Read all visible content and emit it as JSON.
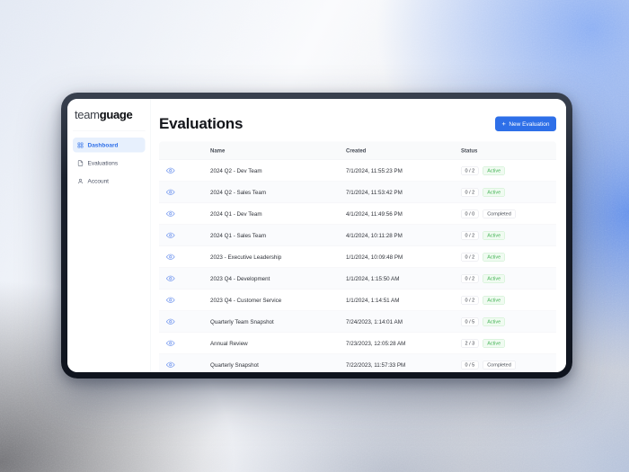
{
  "colors": {
    "accent": "#2e6fe8",
    "active_item_bg": "#e7f0fd",
    "status_green": "#44b355",
    "frame_dark": "#141a26"
  },
  "logo": {
    "part1": "team",
    "part2": "guage"
  },
  "sidebar": {
    "items": [
      {
        "label": "Dashboard",
        "icon": "dashboard-grid-icon",
        "active": true
      },
      {
        "label": "Evaluations",
        "icon": "document-icon",
        "active": false
      },
      {
        "label": "Account",
        "icon": "user-icon",
        "active": false
      }
    ]
  },
  "header": {
    "title": "Evaluations",
    "new_button_plus": "+",
    "new_button_label": "New Evaluation"
  },
  "table": {
    "columns": [
      "Name",
      "Created",
      "Status"
    ],
    "rows": [
      {
        "name": "2024 Q2 - Dev Team",
        "created": "7/1/2024, 11:55:23 PM",
        "count": "0 / 2",
        "status": "Active"
      },
      {
        "name": "2024 Q2 - Sales Team",
        "created": "7/1/2024, 11:53:42 PM",
        "count": "0 / 2",
        "status": "Active"
      },
      {
        "name": "2024 Q1 - Dev Team",
        "created": "4/1/2024, 11:49:56 PM",
        "count": "0 / 0",
        "status": "Completed"
      },
      {
        "name": "2024 Q1 - Sales Team",
        "created": "4/1/2024, 10:11:28 PM",
        "count": "0 / 2",
        "status": "Active"
      },
      {
        "name": "2023 - Executive Leadership",
        "created": "1/1/2024, 10:09:48 PM",
        "count": "0 / 2",
        "status": "Active"
      },
      {
        "name": "2023 Q4 - Development",
        "created": "1/1/2024, 1:15:50 AM",
        "count": "0 / 2",
        "status": "Active"
      },
      {
        "name": "2023 Q4 - Customer Service",
        "created": "1/1/2024, 1:14:51 AM",
        "count": "0 / 2",
        "status": "Active"
      },
      {
        "name": "Quarterly Team Snapshot",
        "created": "7/24/2023, 1:14:01 AM",
        "count": "0 / 5",
        "status": "Active"
      },
      {
        "name": "Annual Review",
        "created": "7/23/2023, 12:05:28 AM",
        "count": "2 / 3",
        "status": "Active"
      },
      {
        "name": "Quarterly Snapshot",
        "created": "7/22/2023, 11:57:33 PM",
        "count": "0 / 5",
        "status": "Completed"
      }
    ]
  }
}
